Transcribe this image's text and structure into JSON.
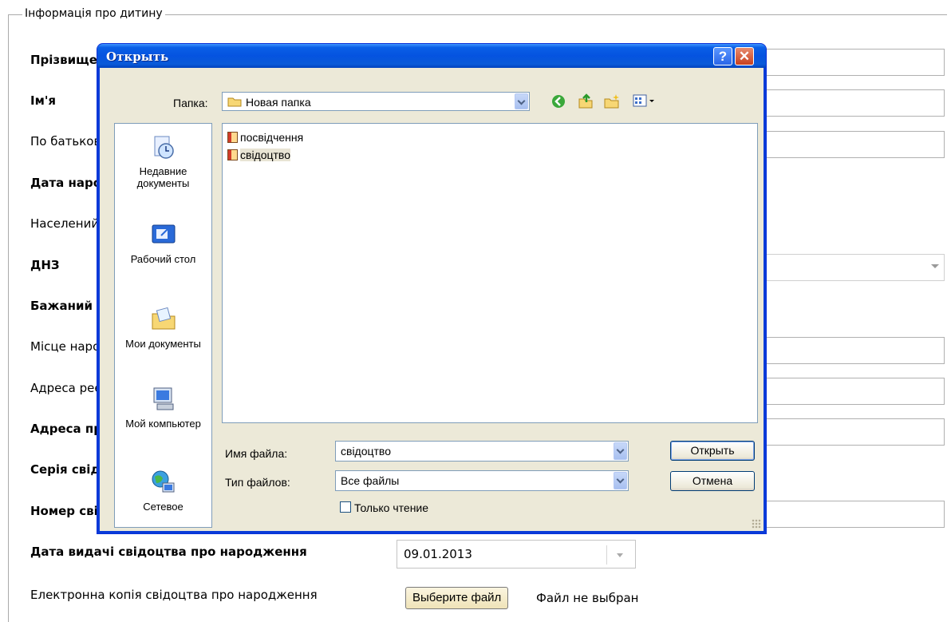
{
  "form": {
    "legend": "Інформація про дитину",
    "fields": [
      {
        "label": "Прізвище",
        "bold": true
      },
      {
        "label": "Ім'я",
        "bold": true
      },
      {
        "label": "По батькові",
        "bold": false
      },
      {
        "label": "Дата народження",
        "bold": true
      },
      {
        "label": "Населений пункт",
        "bold": false
      },
      {
        "label": "ДНЗ",
        "bold": true
      },
      {
        "label": "Бажаний",
        "bold": true
      },
      {
        "label": "Місце народження",
        "bold": false
      },
      {
        "label": "Адреса реєстрації",
        "bold": false
      },
      {
        "label": "Адреса проживання",
        "bold": true
      },
      {
        "label": "Серія свідоцтва",
        "bold": true
      },
      {
        "label": "Номер свідоцтва",
        "bold": true
      }
    ],
    "issue_date_label": "Дата видачі свідоцтва про народження",
    "issue_date_value": "09.01.2013",
    "copy_label": "Електронна копія свідоцтва про народження",
    "choose_file_button": "Выберите файл",
    "no_file_text": "Файл не выбран"
  },
  "dialog": {
    "title": "Открыть",
    "help_button": "?",
    "close_button": "✕",
    "folder_label": "Папка:",
    "folder_value": "Новая папка",
    "places": [
      "Недавние документы",
      "Рабочий стол",
      "Мои документы",
      "Мой компьютер",
      "Сетевое"
    ],
    "files": [
      "посвідчення",
      "свідоцтво"
    ],
    "filename_label": "Имя файла:",
    "filename_value": "свідоцтво",
    "filetype_label": "Тип файлов:",
    "filetype_value": "Все файлы",
    "readonly_label": "Только чтение",
    "open_button": "Открыть",
    "cancel_button": "Отмена"
  }
}
